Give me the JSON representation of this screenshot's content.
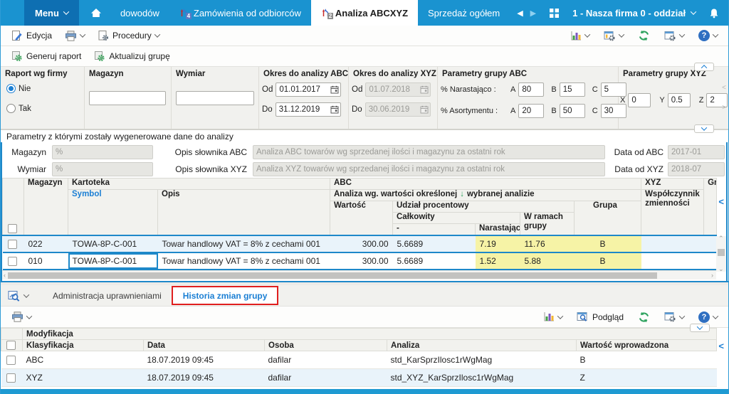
{
  "titlebar": {
    "menu_label": "Menu",
    "tabs": [
      {
        "label": "dowodów",
        "badge": ""
      },
      {
        "label": "Zamówienia od odbiorców",
        "badge": "4"
      },
      {
        "label": "Analiza ABCXYZ",
        "badge": "2"
      },
      {
        "label": "Sprzedaż ogółem",
        "badge": ""
      }
    ],
    "company": "1 - Nasza firma 0 - oddział"
  },
  "glyphs": {
    "help": "?",
    "close": "×",
    "minimize": "—",
    "sort_down": "↓",
    "nav_prev": "◀",
    "nav_next": "▶",
    "collapse_left": "<",
    "scroll_up": "∧",
    "scroll_down": "∨",
    "scroll_left": "‹",
    "scroll_right": "›"
  },
  "toolbar_top": {
    "edit": "Edycja",
    "procedures": "Procedury"
  },
  "toolbar_actions": {
    "generate": "Generuj raport",
    "update": "Aktualizuj grupę"
  },
  "filters": {
    "report_by_company": {
      "label": "Raport wg firmy",
      "option_no": "Nie",
      "option_yes": "Tak"
    },
    "magazyn": {
      "label": "Magazyn",
      "value": ""
    },
    "wymiar": {
      "label": "Wymiar",
      "value": ""
    },
    "okres_abc": {
      "label": "Okres do analizy ABC",
      "od_label": "Od",
      "od": "01.01.2017",
      "do_label": "Do",
      "do": "31.12.2019"
    },
    "okres_xyz": {
      "label": "Okres do analizy XYZ",
      "od_label": "Od",
      "od": "01.07.2018",
      "do_label": "Do",
      "do": "30.06.2019"
    },
    "grupa_abc": {
      "label": "Parametry grupy ABC",
      "row1_label": "% Narastająco :",
      "row2_label": "% Asortymentu :",
      "a_label": "A",
      "b_label": "B",
      "c_label": "C",
      "narastajaco": {
        "a": "80",
        "b": "15",
        "c": "5"
      },
      "asortyment": {
        "a": "20",
        "b": "50",
        "c": "30"
      }
    },
    "grupa_xyz": {
      "label": "Parametry grupy XYZ",
      "x_label": "X",
      "y_label": "Y",
      "z_label": "Z",
      "x": "0",
      "y": "0.5",
      "z": "2"
    }
  },
  "params": {
    "title": "Parametry z którymi zostały wygenerowane dane do analizy",
    "rows": [
      {
        "label": "Magazyn",
        "value": "%",
        "desc_label": "Opis słownika ABC",
        "desc": "Analiza ABC towarów wg sprzedanej ilości i magazynu za ostatni rok",
        "date_label": "Data od ABC",
        "date": "2017-01"
      },
      {
        "label": "Wymiar",
        "value": "%",
        "desc_label": "Opis słownika XYZ",
        "desc": "Analiza XYZ towarów wg sprzedanej ilości i magazynu za ostatni rok",
        "date_label": "Data od XYZ",
        "date": "2018-07"
      }
    ]
  },
  "main_grid": {
    "headers": {
      "magazyn": "Magazyn",
      "kartoteka": "Kartoteka",
      "symbol": "Symbol",
      "opis": "Opis",
      "abc": "ABC",
      "abc_note_left": "Analiza wg. wartości określonej",
      "abc_note_right": "wybranej analizie",
      "wartosc": "Wartość",
      "udzial": "Udział procentowy",
      "calkowity": "Całkowity",
      "dash": "-",
      "narastajaco": "Narastająco",
      "w_ramach": "W ramach grupy",
      "grupa": "Grupa",
      "xyz": "XYZ",
      "wspolczynnik": "Współczynnik zmienności",
      "grupa_cut": "Gru"
    },
    "rows": [
      {
        "magazyn": "022",
        "symbol": "TOWA-8P-C-001",
        "opis": "Towar handlowy VAT = 8% z cechami 001",
        "wartosc": "300.00",
        "calkowity": "5.6689",
        "narastajaco": "7.19",
        "w_ramach": "11.76",
        "grupa": "B"
      },
      {
        "magazyn": "010",
        "symbol": "TOWA-8P-C-001",
        "opis": "Towar handlowy VAT = 8% z cechami 001",
        "wartosc": "300.00",
        "calkowity": "5.6689",
        "narastajaco": "1.52",
        "w_ramach": "5.88",
        "grupa": "B"
      }
    ]
  },
  "bottom_panel": {
    "tabs": [
      {
        "label": "Administracja uprawnieniami"
      },
      {
        "label": "Historia zmian grupy"
      }
    ],
    "preview_label": "Podgląd"
  },
  "history_grid": {
    "group_header": "Modyfikacja",
    "columns": [
      "Klasyfikacja",
      "Data",
      "Osoba",
      "Analiza",
      "Wartość wprowadzona"
    ],
    "rows": [
      [
        "ABC",
        "18.07.2019 09:45",
        "dafilar",
        "std_KarSprzIlosc1rWgMag",
        "B"
      ],
      [
        "XYZ",
        "18.07.2019 09:45",
        "dafilar",
        "std_XYZ_KarSprzIlosc1rWgMag",
        "Z"
      ]
    ]
  }
}
